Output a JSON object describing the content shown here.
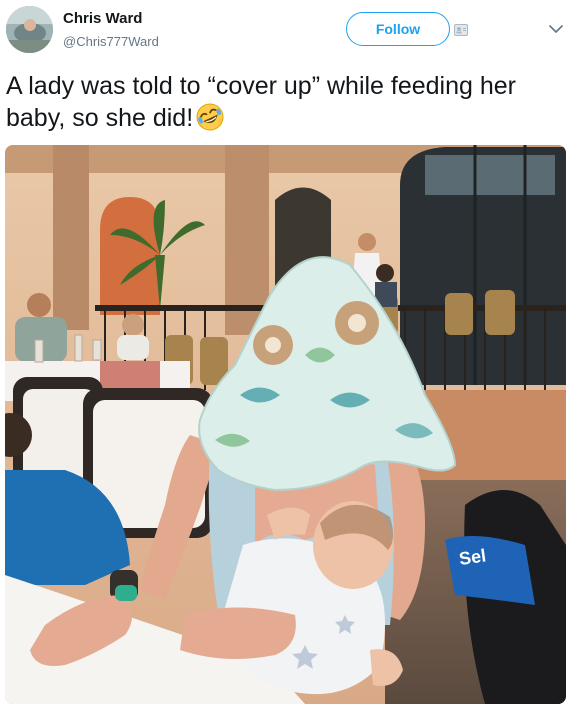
{
  "author": {
    "name": "Chris Ward",
    "handle": "@Chris777Ward"
  },
  "actions": {
    "follow_label": "Follow"
  },
  "tweet": {
    "text": "A lady was told to “cover up” while feeding her baby, so she did!",
    "emoji": "rolling-on-floor-laughing-emoji"
  },
  "photo": {
    "microphone_text": "Sel"
  },
  "colors": {
    "follow_blue": "#1da1f2",
    "name_text": "#14171a",
    "handle_text": "#657786"
  }
}
